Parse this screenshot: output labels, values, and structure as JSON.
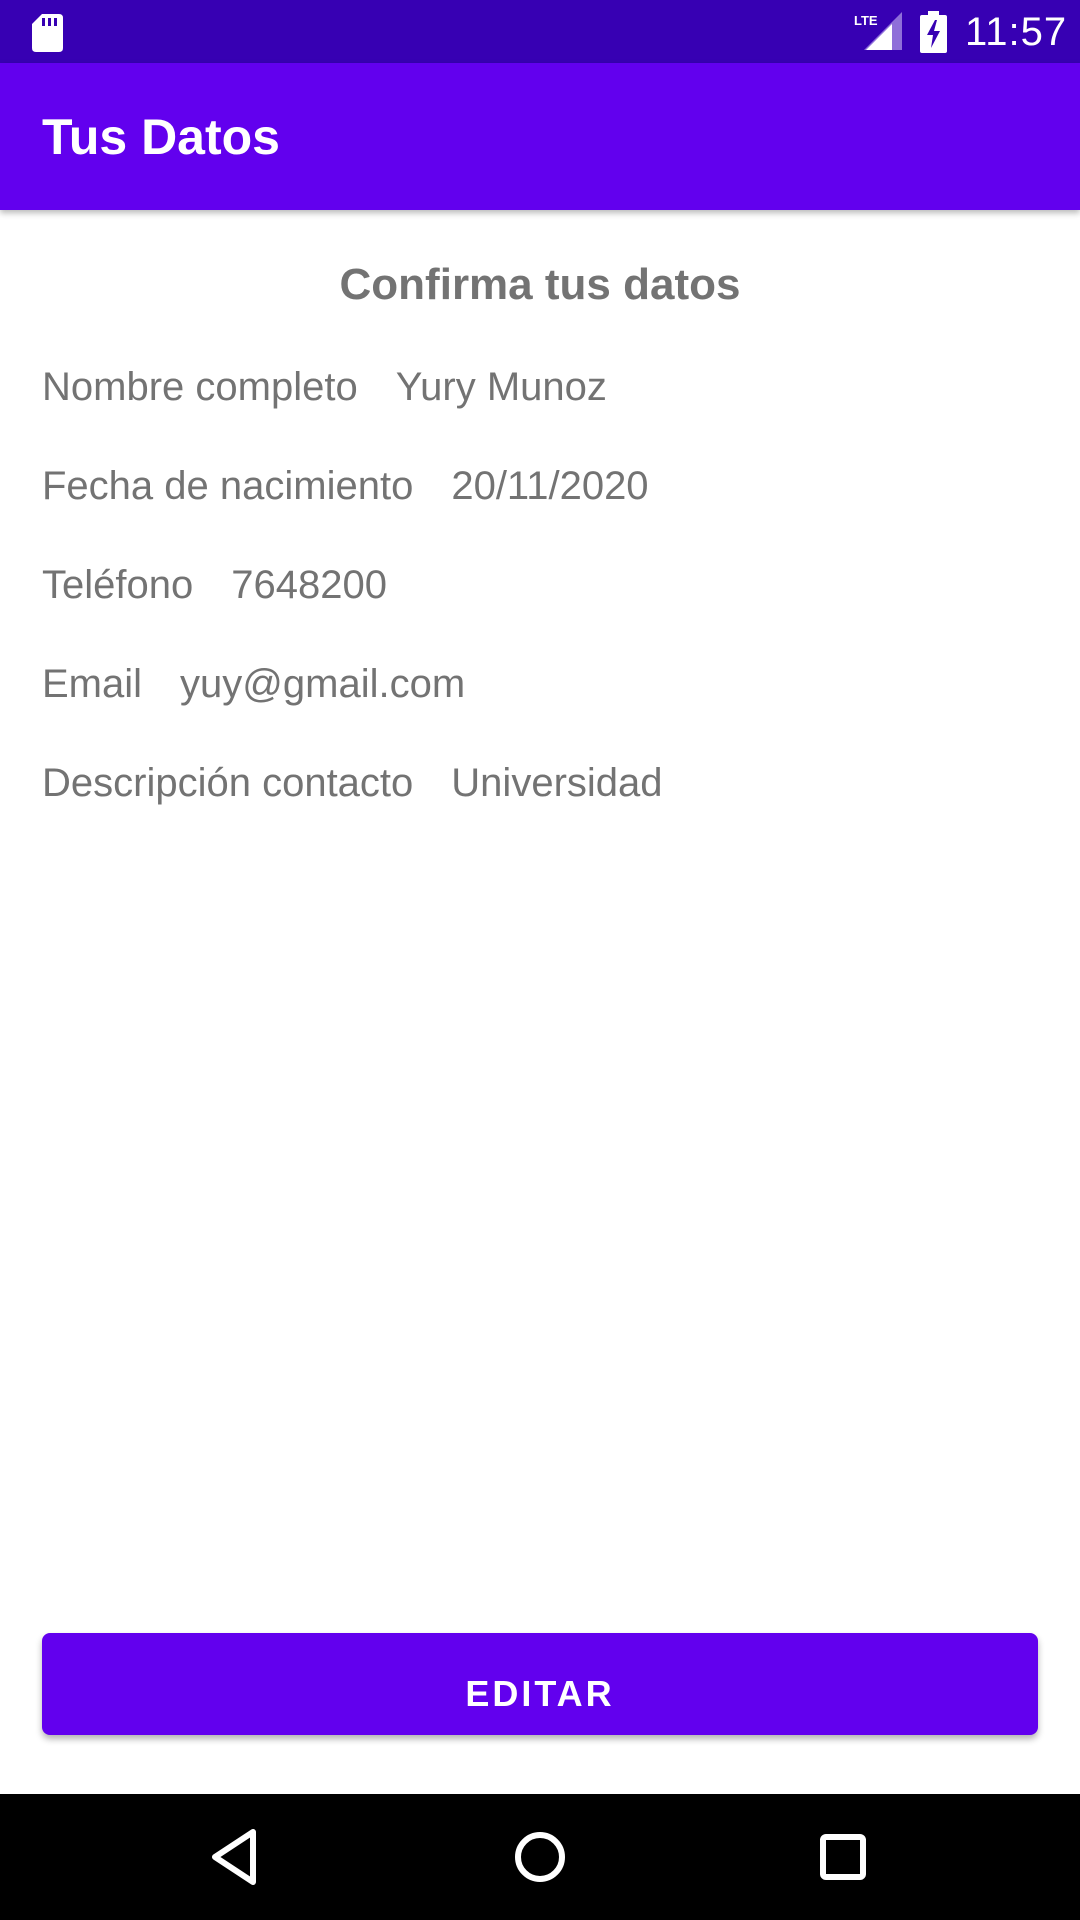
{
  "status_bar": {
    "time": "11:57",
    "network": "LTE",
    "icons": [
      "sd-card-icon",
      "lte-signal-icon",
      "battery-charging-icon"
    ],
    "background": "#3700b3"
  },
  "app_bar": {
    "title": "Tus Datos",
    "background": "#6200ee"
  },
  "content": {
    "heading": "Confirma tus datos",
    "fields": [
      {
        "label": "Nombre completo",
        "value": "Yury Munoz"
      },
      {
        "label": "Fecha de nacimiento",
        "value": "20/11/2020"
      },
      {
        "label": "Teléfono",
        "value": "7648200"
      },
      {
        "label": "Email",
        "value": "yuy@gmail.com"
      },
      {
        "label": "Descripción contacto",
        "value": "Universidad"
      }
    ]
  },
  "actions": {
    "edit_label": "EDITAR",
    "accent": "#6200ee"
  },
  "nav_bar": {
    "icons": [
      "back-icon",
      "home-icon",
      "recents-icon"
    ]
  }
}
